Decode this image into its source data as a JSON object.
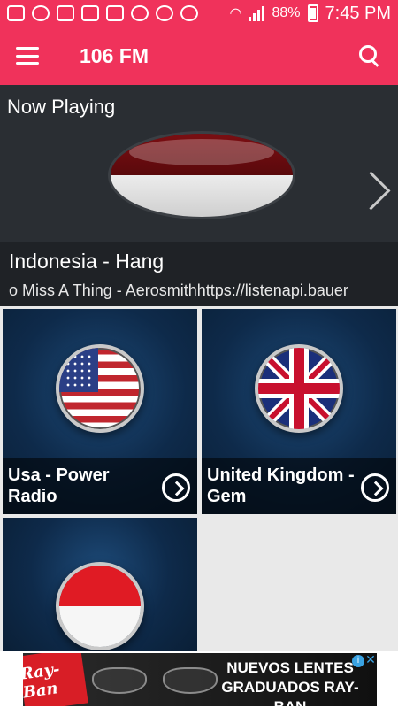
{
  "status_bar": {
    "battery": "88%",
    "time": "7:45 PM",
    "icons": [
      "messaging-icon",
      "shield-icon",
      "tablet-icon",
      "radio-icon",
      "image-icon",
      "shield-icon",
      "chrome-icon",
      "weather-icon",
      "wifi-icon",
      "signal-icon",
      "battery-icon"
    ]
  },
  "appbar": {
    "title": "106 FM"
  },
  "now_playing": {
    "label": "Now Playing",
    "station": "Indonesia - Hang",
    "track": "o Miss A Thing  -  Aerosmithhttps://listenapi.bauer"
  },
  "stations": [
    {
      "line1": "Usa - Power",
      "line2": "Radio",
      "flag": "usa"
    },
    {
      "line1": "United Kingdom -",
      "line2": "Gem",
      "flag": "uk"
    },
    {
      "line1": "",
      "line2": "",
      "flag": "indonesia"
    }
  ],
  "ad": {
    "brand": "Ray-Ban",
    "line1": "NUEVOS LENTES",
    "line2": "GRADUADOS RAY-BAN",
    "info": "i",
    "close": "✕"
  },
  "colors": {
    "primary": "#f0325b",
    "now_bg": "#2a2e33",
    "card_bg": "#0e2a4a"
  }
}
